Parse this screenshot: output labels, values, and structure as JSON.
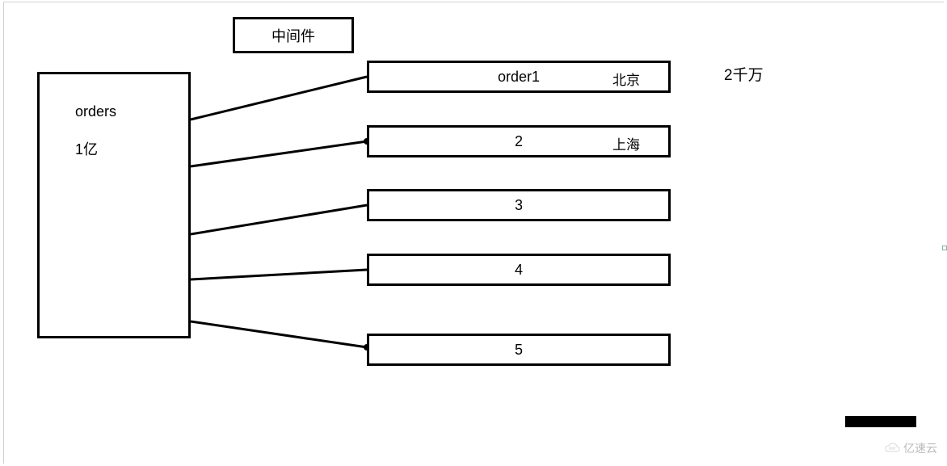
{
  "middleware": {
    "label": "中间件"
  },
  "source": {
    "name": "orders",
    "count": "1亿"
  },
  "shards": [
    {
      "id": "order1",
      "tag": "北京"
    },
    {
      "id": "2",
      "tag": "上海"
    },
    {
      "id": "3",
      "tag": ""
    },
    {
      "id": "4",
      "tag": ""
    },
    {
      "id": "5",
      "tag": ""
    }
  ],
  "shard_size_label": "2千万",
  "watermark": "亿速云"
}
